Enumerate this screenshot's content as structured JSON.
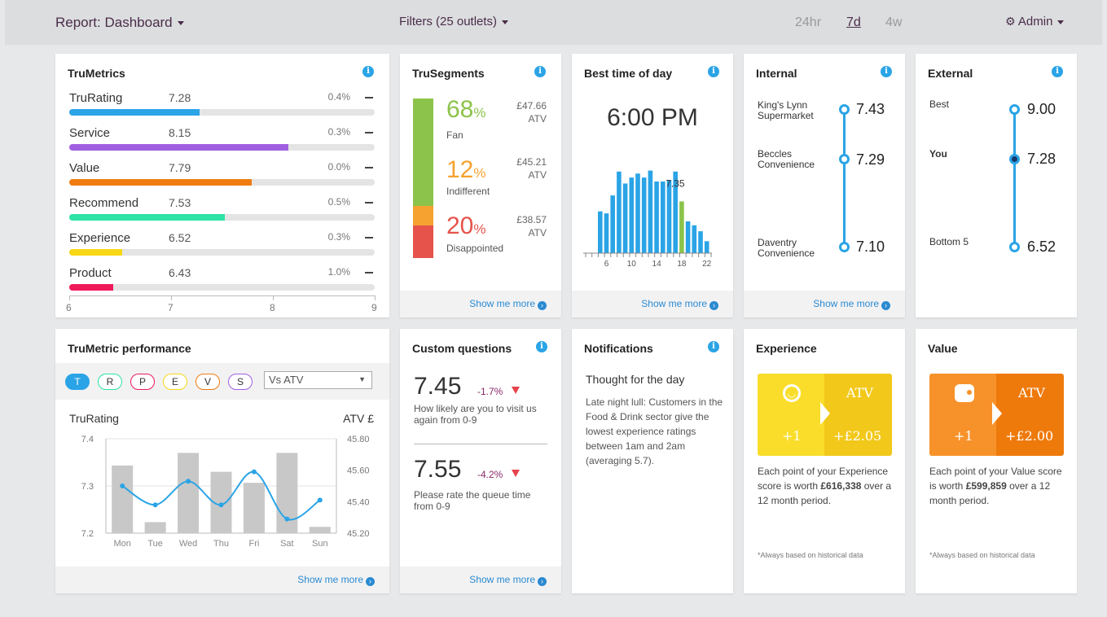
{
  "header": {
    "report": "Report: Dashboard",
    "filters": "Filters (25 outlets)",
    "periods": [
      "24hr",
      "7d",
      "4w"
    ],
    "active_period": "7d",
    "admin": "Admin"
  },
  "common": {
    "show_more": "Show me more",
    "info": "i"
  },
  "trumetrics": {
    "title": "TruMetrics",
    "axis_ticks": [
      "6",
      "7",
      "8",
      "9"
    ],
    "axis_range": [
      6,
      9
    ],
    "rows": [
      {
        "name": "TruRating",
        "value": "7.28",
        "change": "0.4%",
        "color": "#2aa4e6"
      },
      {
        "name": "Service",
        "value": "8.15",
        "change": "0.3%",
        "color": "#a05fe0"
      },
      {
        "name": "Value",
        "value": "7.79",
        "change": "0.0%",
        "color": "#f07c10"
      },
      {
        "name": "Recommend",
        "value": "7.53",
        "change": "0.5%",
        "color": "#2de3a5"
      },
      {
        "name": "Experience",
        "value": "6.52",
        "change": "0.3%",
        "color": "#f7d716"
      },
      {
        "name": "Product",
        "value": "6.43",
        "change": "1.0%",
        "color": "#f0195a"
      }
    ]
  },
  "trusegments": {
    "title": "TruSegments",
    "segments": [
      {
        "pct": "68",
        "unit": "%",
        "label": "Fan",
        "amount": "£47.66",
        "atv": "ATV",
        "color": "#8cc34a"
      },
      {
        "pct": "12",
        "unit": "%",
        "label": "Indifferent",
        "amount": "£45.21",
        "atv": "ATV",
        "color": "#f5a230"
      },
      {
        "pct": "20",
        "unit": "%",
        "label": "Disappointed",
        "amount": "£38.57",
        "atv": "ATV",
        "color": "#e5534b"
      }
    ]
  },
  "best_time": {
    "title": "Best time of day",
    "time": "6:00 PM",
    "peak_label": "7.35",
    "x_ticks": [
      "6",
      "10",
      "14",
      "18",
      "22"
    ],
    "chart_data": {
      "type": "bar",
      "x_start_hour": 5,
      "values": [
        4.2,
        4.0,
        5.8,
        8.2,
        7.0,
        7.6,
        8.0,
        7.6,
        8.3,
        7.2,
        7.2,
        7.35,
        8.2,
        5.2,
        3.2,
        2.8,
        2.2,
        1.2
      ],
      "highlight_index": 13,
      "highlight_color": "#8cc34a",
      "bar_color": "#2aa4e6"
    }
  },
  "internal": {
    "title": "Internal",
    "items": [
      {
        "name": "King's Lynn Supermarket",
        "value": "7.43"
      },
      {
        "name": "Beccles Convenience",
        "value": "7.29"
      },
      {
        "name": "Daventry Convenience",
        "value": "7.10"
      }
    ]
  },
  "external": {
    "title": "External",
    "items": [
      {
        "name": "Best",
        "value": "9.00"
      },
      {
        "name": "You",
        "value": "7.28"
      },
      {
        "name": "Bottom 5",
        "value": "6.52"
      }
    ]
  },
  "performance": {
    "title": "TruMetric performance",
    "pills": [
      {
        "label": "T",
        "color": "#2aa4e6",
        "active": true
      },
      {
        "label": "R",
        "color": "#2de3a5",
        "active": false
      },
      {
        "label": "P",
        "color": "#f0195a",
        "active": false
      },
      {
        "label": "E",
        "color": "#f7d716",
        "active": false
      },
      {
        "label": "V",
        "color": "#f07c10",
        "active": false
      },
      {
        "label": "S",
        "color": "#a05fe0",
        "active": false
      }
    ],
    "select_value": "Vs ATV",
    "left_label": "TruRating",
    "right_label": "ATV £",
    "chart_data": {
      "type": "bar",
      "categories": [
        "Mon",
        "Tue",
        "Wed",
        "Thu",
        "Fri",
        "Sat",
        "Sun"
      ],
      "series": [
        {
          "name": "ATV £",
          "type": "bar",
          "values": [
            45.63,
            45.27,
            45.71,
            45.59,
            45.52,
            45.71,
            45.24
          ],
          "color": "#c8c8c8"
        },
        {
          "name": "TruRating",
          "type": "line",
          "values": [
            7.3,
            7.26,
            7.31,
            7.26,
            7.33,
            7.23,
            7.27
          ],
          "color": "#2aa4e6"
        }
      ],
      "y_left": {
        "ticks": [
          "7.4",
          "7.3",
          "7.2"
        ],
        "range": [
          7.2,
          7.4
        ]
      },
      "y_right": {
        "ticks": [
          "45.80",
          "45.60",
          "45.40",
          "45.20"
        ],
        "range": [
          45.2,
          45.8
        ]
      }
    }
  },
  "custom_questions": {
    "title": "Custom questions",
    "items": [
      {
        "value": "7.45",
        "change": "-1.7%",
        "question": "How likely are you to visit us again from 0-9"
      },
      {
        "value": "7.55",
        "change": "-4.2%",
        "question": "Please rate the queue time from 0-9"
      }
    ]
  },
  "notifications": {
    "title": "Notifications",
    "subtitle": "Thought for the day",
    "body": "Late night lull: Customers in the Food & Drink sector give the lowest experience ratings between 1am and 2am (averaging 5.7)."
  },
  "experience": {
    "title": "Experience",
    "atv": "ATV",
    "plus": "+1",
    "amount": "+£2.05",
    "text1": "Each point of your Experience score is worth ",
    "bold": "£616,338",
    "text2": " over a 12 month period.",
    "note": "*Always based on historical data",
    "light": "#f9dd2a",
    "dark": "#f2c81a"
  },
  "value": {
    "title": "Value",
    "atv": "ATV",
    "plus": "+1",
    "amount": "+£2.00",
    "text1": "Each point of your Value score is worth ",
    "bold": "£599,859",
    "text2": " over a 12 month period.",
    "note": "*Always based on historical data",
    "light": "#f7922a",
    "dark": "#ee7a0c"
  }
}
